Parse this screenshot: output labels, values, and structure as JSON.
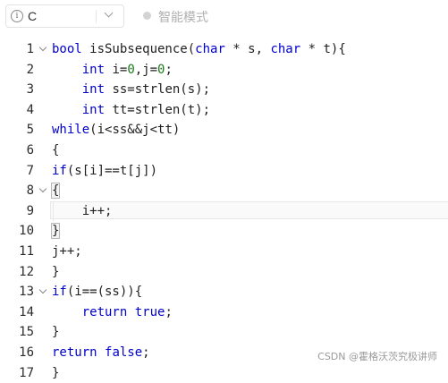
{
  "toolbar": {
    "language": "C",
    "mode_label": "智能模式"
  },
  "editor": {
    "lines": [
      {
        "num": "1",
        "fold": true,
        "text": "bool isSubsequence(char * s, char * t){"
      },
      {
        "num": "2",
        "fold": false,
        "text": "    int i=0,j=0;"
      },
      {
        "num": "3",
        "fold": false,
        "text": "    int ss=strlen(s);"
      },
      {
        "num": "4",
        "fold": false,
        "text": "    int tt=strlen(t);"
      },
      {
        "num": "5",
        "fold": false,
        "text": "while(i<ss&&j<tt)"
      },
      {
        "num": "6",
        "fold": false,
        "text": "{"
      },
      {
        "num": "7",
        "fold": false,
        "text": "if(s[i]==t[j])"
      },
      {
        "num": "8",
        "fold": true,
        "text": "{"
      },
      {
        "num": "9",
        "fold": false,
        "text": "    i++;"
      },
      {
        "num": "10",
        "fold": false,
        "text": "}"
      },
      {
        "num": "11",
        "fold": false,
        "text": "j++;"
      },
      {
        "num": "12",
        "fold": false,
        "text": "}"
      },
      {
        "num": "13",
        "fold": true,
        "text": "if(i==(ss)){"
      },
      {
        "num": "14",
        "fold": false,
        "text": "    return true;"
      },
      {
        "num": "15",
        "fold": false,
        "text": "}"
      },
      {
        "num": "16",
        "fold": false,
        "text": "return false;"
      },
      {
        "num": "17",
        "fold": false,
        "text": "}"
      }
    ],
    "active_line": 9
  },
  "watermark": "CSDN @霍格沃茨究极讲师",
  "colors": {
    "keyword": "#0000cc",
    "number": "#1a7a1a",
    "text": "#1f1f1f",
    "line_number": "#2b2b2b"
  },
  "icons": {
    "info": "info-circle-icon",
    "dropdown": "chevron-down-icon",
    "fold": "fold-chevron-icon",
    "mode": "toggle-dot-icon"
  }
}
